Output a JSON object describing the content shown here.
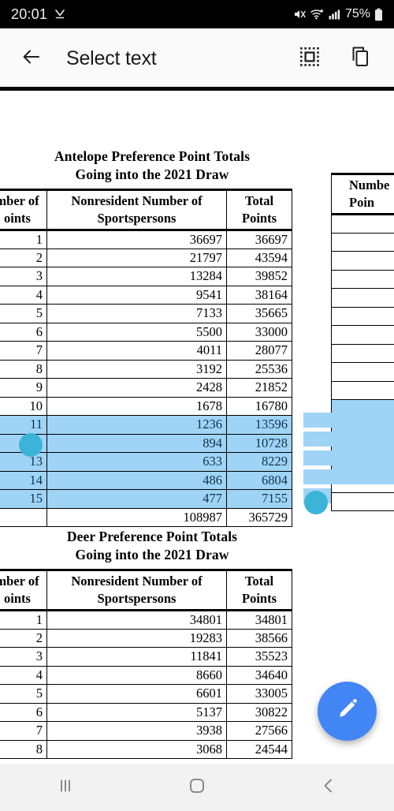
{
  "statusbar": {
    "time": "20:01",
    "download_icon": "download-indicator-icon",
    "mute_icon": "volume-mute-icon",
    "wifi_icon": "wifi-plus-icon",
    "signal_icon": "cellular-signal-icon",
    "battery_percent": "75%",
    "battery_icon": "battery-icon"
  },
  "toolbar": {
    "back_icon": "arrow-back-icon",
    "title": "Select text",
    "select_all_icon": "select-all-icon",
    "copy_icon": "copy-icon"
  },
  "colors": {
    "accent_fab": "#4285f4",
    "selection_highlight": "#9fd4f7",
    "selection_handle": "#3cb4d8",
    "toolbar_bg": "#fafafa",
    "statusbar_bg": "#000000",
    "navbar_bg": "#f2f2f2"
  },
  "document": {
    "tables": [
      {
        "id": "antelope",
        "title_line1": "Antelope Preference Point Totals",
        "title_line2": "Going into the 2021 Draw",
        "headers": {
          "points": "Number of Points",
          "points_visible": "mber of",
          "points_visible2": "oints",
          "sportspersons_line1": "Nonresident Number of",
          "sportspersons_line2": "Sportspersons",
          "total_line1": "Total",
          "total_line2": "Points"
        },
        "rows": [
          {
            "points": "1",
            "sportspersons": "36697",
            "total": "36697",
            "selected": false
          },
          {
            "points": "2",
            "sportspersons": "21797",
            "total": "43594",
            "selected": false
          },
          {
            "points": "3",
            "sportspersons": "13284",
            "total": "39852",
            "selected": false
          },
          {
            "points": "4",
            "sportspersons": "9541",
            "total": "38164",
            "selected": false
          },
          {
            "points": "5",
            "sportspersons": "7133",
            "total": "35665",
            "selected": false
          },
          {
            "points": "6",
            "sportspersons": "5500",
            "total": "33000",
            "selected": false
          },
          {
            "points": "7",
            "sportspersons": "4011",
            "total": "28077",
            "selected": false
          },
          {
            "points": "8",
            "sportspersons": "3192",
            "total": "25536",
            "selected": false
          },
          {
            "points": "9",
            "sportspersons": "2428",
            "total": "21852",
            "selected": false
          },
          {
            "points": "10",
            "sportspersons": "1678",
            "total": "16780",
            "selected": false
          },
          {
            "points": "11",
            "sportspersons": "1236",
            "total": "13596",
            "selected": true
          },
          {
            "points": "12",
            "sportspersons": "894",
            "total": "10728",
            "selected": true
          },
          {
            "points": "13",
            "sportspersons": "633",
            "total": "8229",
            "selected": true
          },
          {
            "points": "14",
            "sportspersons": "486",
            "total": "6804",
            "selected": true
          },
          {
            "points": "15",
            "sportspersons": "477",
            "total": "7155",
            "selected": true
          },
          {
            "points": "",
            "sportspersons": "108987",
            "total": "365729",
            "selected": false
          }
        ]
      },
      {
        "id": "deer",
        "title_line1": "Deer Preference Point Totals",
        "title_line2": "Going into the 2021 Draw",
        "headers": {
          "points_visible": "mber of",
          "points_visible2": "oints",
          "sportspersons_line1": "Nonresident Number of",
          "sportspersons_line2": "Sportspersons",
          "total_line1": "Total",
          "total_line2": "Points"
        },
        "rows": [
          {
            "points": "1",
            "sportspersons": "34801",
            "total": "34801",
            "selected": false
          },
          {
            "points": "2",
            "sportspersons": "19283",
            "total": "38566",
            "selected": false
          },
          {
            "points": "3",
            "sportspersons": "11841",
            "total": "35523",
            "selected": false
          },
          {
            "points": "4",
            "sportspersons": "8660",
            "total": "34640",
            "selected": false
          },
          {
            "points": "5",
            "sportspersons": "6601",
            "total": "33005",
            "selected": false
          },
          {
            "points": "6",
            "sportspersons": "5137",
            "total": "30822",
            "selected": false
          },
          {
            "points": "7",
            "sportspersons": "3938",
            "total": "27566",
            "selected": false
          },
          {
            "points": "8",
            "sportspersons": "3068",
            "total": "24544",
            "selected": false
          }
        ]
      }
    ],
    "right_table": {
      "header_line1": "Numbe",
      "header_line2": "Poin",
      "row_count": 16
    }
  },
  "fab": {
    "icon": "edit-pencil-icon",
    "label": "Edit"
  },
  "navbar": {
    "recents_icon": "recents-icon",
    "home_icon": "home-icon",
    "back_icon": "nav-back-icon"
  }
}
